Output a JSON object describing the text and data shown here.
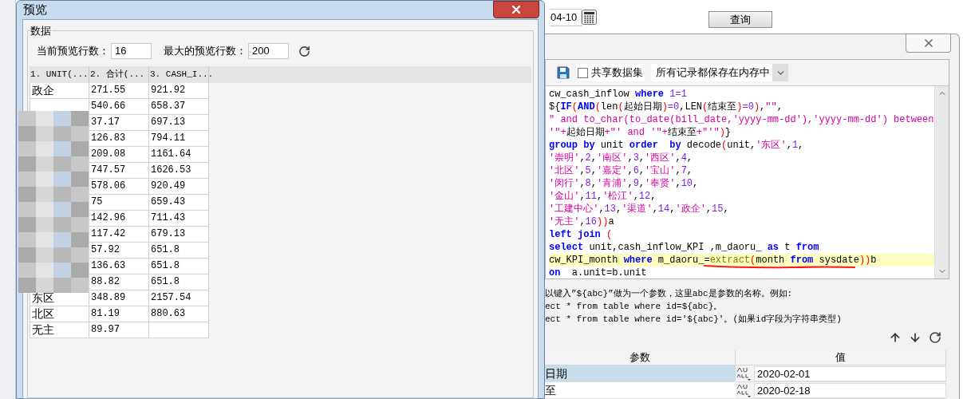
{
  "background_app": {
    "date_field": "04-10",
    "query_button": "查询"
  },
  "preview_dialog": {
    "title": "预览",
    "group_title": "数据",
    "current_rows_label": "当前预览行数：",
    "current_rows": "16",
    "max_rows_label": "最大的预览行数：",
    "max_rows": "200",
    "table": {
      "columns": [
        "1. UNIT(...",
        "2. 合计(...",
        "3. CASH_I..."
      ],
      "rows": [
        {
          "unit": "政企",
          "total": "271.55",
          "cash": "921.92"
        },
        {
          "total": "540.66",
          "cash": "658.37"
        },
        {
          "total": "37.17",
          "cash": "697.13"
        },
        {
          "total": "126.83",
          "cash": "794.11"
        },
        {
          "total": "209.08",
          "cash": "1161.64"
        },
        {
          "total": "747.57",
          "cash": "1626.53"
        },
        {
          "total": "578.06",
          "cash": "920.49"
        },
        {
          "total": "75",
          "cash": "659.43"
        },
        {
          "total": "142.96",
          "cash": "711.43"
        },
        {
          "total": "117.42",
          "cash": "679.13"
        },
        {
          "total": "57.92",
          "cash": "651.8"
        },
        {
          "total": "136.63",
          "cash": "651.8"
        },
        {
          "total": "88.82",
          "cash": "651.8"
        },
        {
          "unit": "东区",
          "total": "348.89",
          "cash": "2157.54"
        },
        {
          "unit": "北区",
          "total": "81.19",
          "cash": "880.63"
        },
        {
          "unit": "无主",
          "total": "89.97"
        }
      ]
    }
  },
  "dataset_dialog": {
    "share_checkbox": {
      "label": "共享数据集",
      "checked": false
    },
    "storage_select": "所有记录都保存在内存中",
    "sql_lines": [
      {
        "highlighted": false,
        "underlined": false,
        "tokens": [
          {
            "kind": "text",
            "s": "cw_cash_inflow "
          },
          {
            "kind": "keyword",
            "s": "where"
          },
          {
            "kind": "number",
            "s": " 1=1"
          }
        ]
      },
      {
        "highlighted": false,
        "underlined": false,
        "tokens": [
          {
            "kind": "text",
            "s": "${"
          },
          {
            "kind": "keyword",
            "s": "IF"
          },
          {
            "kind": "paren",
            "s": "("
          },
          {
            "kind": "keyword",
            "s": "AND"
          },
          {
            "kind": "paren",
            "s": "("
          },
          {
            "kind": "text",
            "s": "len"
          },
          {
            "kind": "paren",
            "s": "("
          },
          {
            "kind": "text",
            "s": "起始日期"
          },
          {
            "kind": "paren",
            "s": ")"
          },
          {
            "kind": "number",
            "s": "=0"
          },
          {
            "kind": "text",
            "s": ",LEN"
          },
          {
            "kind": "paren",
            "s": "("
          },
          {
            "kind": "text",
            "s": "结束至"
          },
          {
            "kind": "paren",
            "s": ")"
          },
          {
            "kind": "number",
            "s": "=0"
          },
          {
            "kind": "paren",
            "s": ")"
          },
          {
            "kind": "text",
            "s": ","
          },
          {
            "kind": "string",
            "s": "\"\""
          },
          {
            "kind": "text",
            "s": ","
          }
        ]
      },
      {
        "highlighted": false,
        "underlined": false,
        "tokens": [
          {
            "kind": "string",
            "s": "\" and to_char(to_date(bill_date,'yyyy-mm-dd'),'yyyy-mm-dd') between"
          }
        ]
      },
      {
        "highlighted": false,
        "underlined": false,
        "tokens": [
          {
            "kind": "string",
            "s": "'\"+"
          },
          {
            "kind": "text",
            "s": "起始日期"
          },
          {
            "kind": "string",
            "s": "+\"' and '\"+"
          },
          {
            "kind": "text",
            "s": "结束至"
          },
          {
            "kind": "string",
            "s": "+\"'\""
          },
          {
            "kind": "paren",
            "s": ")"
          },
          {
            "kind": "text",
            "s": "}"
          }
        ]
      },
      {
        "highlighted": false,
        "underlined": false,
        "tokens": [
          {
            "kind": "keyword",
            "s": "group by"
          },
          {
            "kind": "text",
            "s": " unit "
          },
          {
            "kind": "keyword",
            "s": "order  by"
          },
          {
            "kind": "text",
            "s": " decode"
          },
          {
            "kind": "paren",
            "s": "("
          },
          {
            "kind": "text",
            "s": "unit,"
          },
          {
            "kind": "string",
            "s": "'东区'"
          },
          {
            "kind": "text",
            "s": ","
          },
          {
            "kind": "number",
            "s": "1"
          },
          {
            "kind": "text",
            "s": ","
          }
        ]
      },
      {
        "highlighted": false,
        "underlined": false,
        "tokens": [
          {
            "kind": "string",
            "s": "'崇明'"
          },
          {
            "kind": "text",
            "s": ","
          },
          {
            "kind": "number",
            "s": "2"
          },
          {
            "kind": "text",
            "s": ","
          },
          {
            "kind": "string",
            "s": "'南区'"
          },
          {
            "kind": "text",
            "s": ","
          },
          {
            "kind": "number",
            "s": "3"
          },
          {
            "kind": "text",
            "s": ","
          },
          {
            "kind": "string",
            "s": "'西区'"
          },
          {
            "kind": "text",
            "s": ","
          },
          {
            "kind": "number",
            "s": "4"
          },
          {
            "kind": "text",
            "s": ","
          }
        ]
      },
      {
        "highlighted": false,
        "underlined": false,
        "tokens": [
          {
            "kind": "string",
            "s": "'北区'"
          },
          {
            "kind": "text",
            "s": ","
          },
          {
            "kind": "number",
            "s": "5"
          },
          {
            "kind": "text",
            "s": ","
          },
          {
            "kind": "string",
            "s": "'嘉定'"
          },
          {
            "kind": "text",
            "s": ","
          },
          {
            "kind": "number",
            "s": "6"
          },
          {
            "kind": "text",
            "s": ","
          },
          {
            "kind": "string",
            "s": "'宝山'"
          },
          {
            "kind": "text",
            "s": ","
          },
          {
            "kind": "number",
            "s": "7"
          },
          {
            "kind": "text",
            "s": ","
          }
        ]
      },
      {
        "highlighted": false,
        "underlined": false,
        "tokens": [
          {
            "kind": "string",
            "s": "'闵行'"
          },
          {
            "kind": "text",
            "s": ","
          },
          {
            "kind": "number",
            "s": "8"
          },
          {
            "kind": "text",
            "s": ","
          },
          {
            "kind": "string",
            "s": "'青浦'"
          },
          {
            "kind": "text",
            "s": ","
          },
          {
            "kind": "number",
            "s": "9"
          },
          {
            "kind": "text",
            "s": ","
          },
          {
            "kind": "string",
            "s": "'奉贤'"
          },
          {
            "kind": "text",
            "s": ","
          },
          {
            "kind": "number",
            "s": "10"
          },
          {
            "kind": "text",
            "s": ","
          }
        ]
      },
      {
        "highlighted": false,
        "underlined": false,
        "tokens": [
          {
            "kind": "string",
            "s": "'金山'"
          },
          {
            "kind": "text",
            "s": ","
          },
          {
            "kind": "number",
            "s": "11"
          },
          {
            "kind": "text",
            "s": ","
          },
          {
            "kind": "string",
            "s": "'松江'"
          },
          {
            "kind": "text",
            "s": ","
          },
          {
            "kind": "number",
            "s": "12"
          },
          {
            "kind": "text",
            "s": ","
          }
        ]
      },
      {
        "highlighted": false,
        "underlined": false,
        "tokens": [
          {
            "kind": "string",
            "s": "'工建中心'"
          },
          {
            "kind": "text",
            "s": ","
          },
          {
            "kind": "number",
            "s": "13"
          },
          {
            "kind": "text",
            "s": ","
          },
          {
            "kind": "string",
            "s": "'渠道'"
          },
          {
            "kind": "text",
            "s": ","
          },
          {
            "kind": "number",
            "s": "14"
          },
          {
            "kind": "text",
            "s": ","
          },
          {
            "kind": "string",
            "s": "'政企'"
          },
          {
            "kind": "text",
            "s": ","
          },
          {
            "kind": "number",
            "s": "15"
          },
          {
            "kind": "text",
            "s": ","
          }
        ]
      },
      {
        "highlighted": false,
        "underlined": false,
        "tokens": [
          {
            "kind": "string",
            "s": "'无主'"
          },
          {
            "kind": "text",
            "s": ","
          },
          {
            "kind": "number",
            "s": "16"
          },
          {
            "kind": "paren",
            "s": "))"
          },
          {
            "kind": "text",
            "s": "a"
          }
        ]
      },
      {
        "highlighted": false,
        "underlined": false,
        "tokens": [
          {
            "kind": "keyword",
            "s": "left join"
          },
          {
            "kind": "paren",
            "s": " ("
          }
        ]
      },
      {
        "highlighted": false,
        "underlined": false,
        "tokens": [
          {
            "kind": "keyword",
            "s": "select"
          },
          {
            "kind": "text",
            "s": " unit,cash_inflow_KPI ,m_daoru_ "
          },
          {
            "kind": "keyword",
            "s": "as"
          },
          {
            "kind": "text",
            "s": " t "
          },
          {
            "kind": "keyword",
            "s": "from"
          }
        ]
      },
      {
        "highlighted": true,
        "underlined": true,
        "tokens": [
          {
            "kind": "text",
            "s": "cw_KPI_month "
          },
          {
            "kind": "keyword",
            "s": "where"
          },
          {
            "kind": "text",
            "s": " m_daoru_="
          },
          {
            "kind": "function",
            "s": "extract"
          },
          {
            "kind": "paren",
            "s": "("
          },
          {
            "kind": "text",
            "s": "month "
          },
          {
            "kind": "keyword",
            "s": "from"
          },
          {
            "kind": "text",
            "s": " sysdate"
          },
          {
            "kind": "paren",
            "s": "))"
          },
          {
            "kind": "text",
            "s": "b"
          }
        ]
      },
      {
        "highlighted": false,
        "underlined": false,
        "tokens": [
          {
            "kind": "keyword",
            "s": "on"
          },
          {
            "kind": "text",
            "s": "  a.unit=b.unit"
          }
        ]
      }
    ],
    "help_lines": [
      "以键入”${abc}”做为一个参数，这里abc是参数的名称。例如:",
      "ect * from table where id=${abc}。",
      "ect * from table where id='${abc}'。(如果id字段为字符串类型)"
    ],
    "param_table": {
      "columns": [
        "参数",
        "值"
      ],
      "rows": [
        {
          "name": "日期",
          "value": "2020-02-01",
          "selected": true
        },
        {
          "name": "至",
          "value": "2020-02-18",
          "selected": false
        }
      ]
    }
  }
}
